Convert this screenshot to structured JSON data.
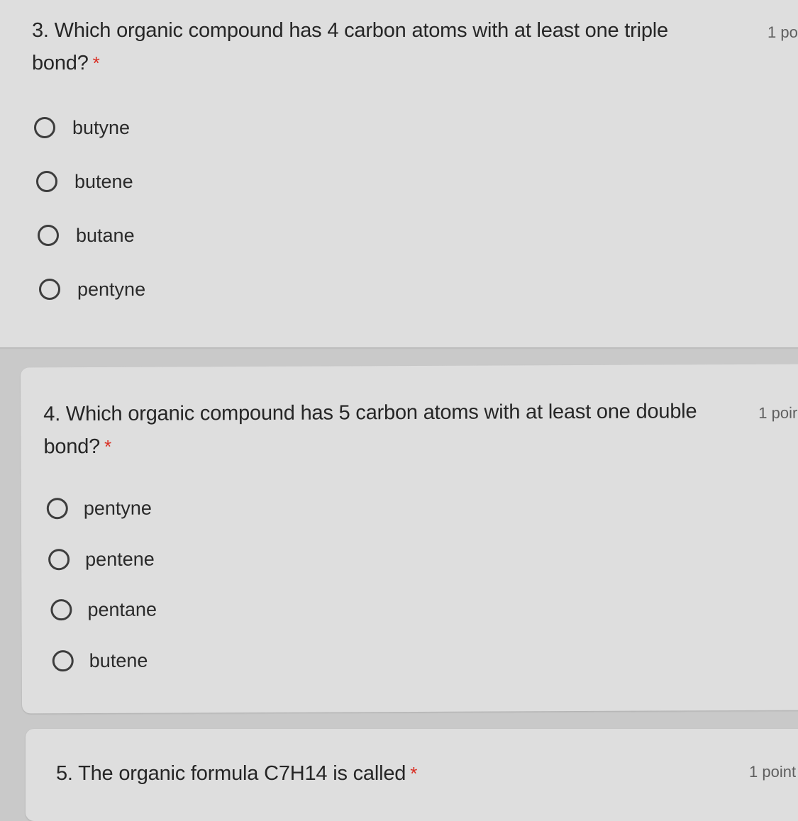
{
  "questions": [
    {
      "text_line1": "3. Which organic compound has 4 carbon atoms with at least one triple",
      "text_line2": "bond?",
      "required_marker": "*",
      "points": "1 po",
      "options": [
        "butyne",
        "butene",
        "butane",
        "pentyne"
      ]
    },
    {
      "text_line1": "4. Which organic compound has 5 carbon atoms with at least one double",
      "text_line2": "bond?",
      "required_marker": "*",
      "points": "1 poir",
      "options": [
        "pentyne",
        "pentene",
        "pentane",
        "butene"
      ]
    },
    {
      "text_line1": "5. The organic formula C7H14 is called",
      "required_marker": "*",
      "points": "1 point"
    }
  ],
  "colors": {
    "page_background": "#c9c9c9",
    "card_background": "#dedede",
    "required_star": "#d93025",
    "radio_border": "#3d3d3d"
  }
}
